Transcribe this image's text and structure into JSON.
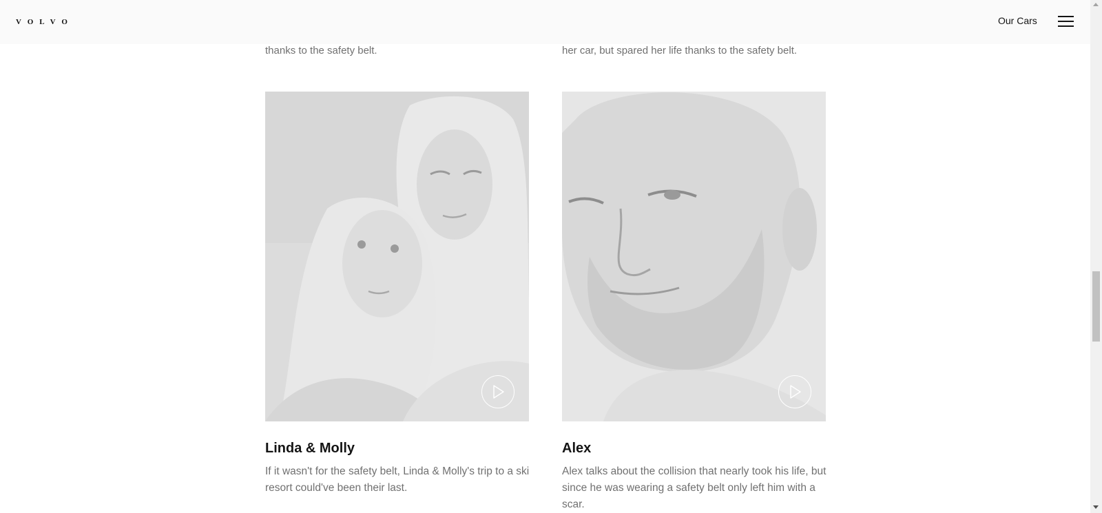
{
  "header": {
    "logo_text": "VOLVO",
    "nav_our_cars": "Our Cars",
    "menu_icon": "hamburger-menu-icon"
  },
  "previous_row": {
    "left_text": "thanks to the safety belt.",
    "right_text": "her car, but spared her life thanks to the safety belt."
  },
  "stories": [
    {
      "name": "Linda & Molly",
      "description": "If it wasn't for the safety belt, Linda & Molly's trip to a ski resort could've been their last.",
      "image": "portrait of a woman and a young girl leaning heads together",
      "play_icon": "play-icon"
    },
    {
      "name": "Alex",
      "description": "Alex talks about the collision that nearly took his life, but since he was wearing a safety belt only left him with a scar.",
      "image": "close-up portrait of a bearded man",
      "play_icon": "play-icon"
    }
  ],
  "colors": {
    "header_bg": "#fafafa",
    "title_text": "#141414",
    "body_text": "#707070",
    "image_tint": "#e3e3e3"
  }
}
